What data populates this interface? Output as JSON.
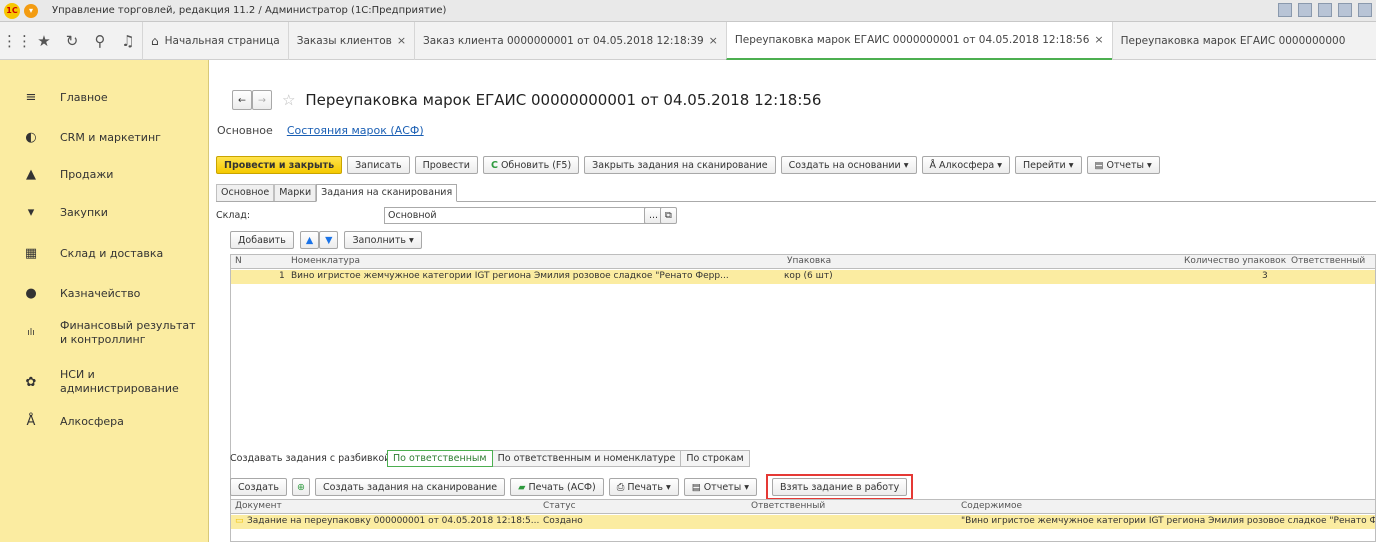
{
  "app_title": "Управление торговлей, редакция 11.2 / Администратор  (1С:Предприятие)",
  "home_tab": "Начальная страница",
  "tabs": [
    {
      "label": "Заказы клиентов",
      "close": "×"
    },
    {
      "label": "Заказ клиента 0000000001 от 04.05.2018 12:18:39",
      "close": "×"
    },
    {
      "label": "Переупаковка марок ЕГАИС 0000000001 от 04.05.2018 12:18:56",
      "close": "×"
    },
    {
      "label": "Переупаковка марок ЕГАИС 0000000000"
    }
  ],
  "sidebar": {
    "items": [
      {
        "icon": "menu-icon",
        "glyph": "≡",
        "label": "Главное"
      },
      {
        "icon": "crm-icon",
        "glyph": "◐",
        "label": "CRM и маркетинг"
      },
      {
        "icon": "bag-icon",
        "glyph": "▲",
        "label": "Продажи"
      },
      {
        "icon": "cart-icon",
        "glyph": "▾",
        "label": "Закупки"
      },
      {
        "icon": "warehouse-icon",
        "glyph": "▦",
        "label": "Склад и доставка"
      },
      {
        "icon": "treasury-icon",
        "glyph": "●",
        "label": "Казначейство"
      },
      {
        "icon": "chart-icon",
        "glyph": "ılı",
        "label": "Финансовый результат и контроллинг"
      },
      {
        "icon": "gear-icon",
        "glyph": "✿",
        "label": "НСИ и администрирование"
      },
      {
        "icon": "alcosphere-icon",
        "glyph": "Å",
        "label": "Алкосфера"
      }
    ]
  },
  "doc": {
    "title": "Переупаковка марок ЕГАИС 00000000001 от 04.05.2018 12:18:56",
    "nav_main": "Основное",
    "nav_link": "Состояния марок (АСФ)"
  },
  "toolbar": {
    "post_close": "Провести и закрыть",
    "save": "Записать",
    "post": "Провести",
    "refresh": "Обновить (F5)",
    "close_tasks": "Закрыть задания на сканирование",
    "create_basis": "Создать на основании",
    "alcosphere": "Алкосфера",
    "goto": "Перейти",
    "reports": "Отчеты"
  },
  "inner_tabs": [
    "Основное",
    "Марки",
    "Задания на сканирования"
  ],
  "warehouse": {
    "label": "Склад:",
    "value": "Основной"
  },
  "table_toolbar": {
    "add": "Добавить",
    "fill": "Заполнить"
  },
  "table": {
    "headers": [
      "N",
      "Номенклатура",
      "Упаковка",
      "Количество упаковок",
      "Ответственный"
    ],
    "rows": [
      {
        "n": "1",
        "nom": "Вино игристое жемчужное категории IGT региона Эмилия розовое сладкое \"Ренато Ферр...",
        "pack": "кор (6 шт)",
        "qty": "3",
        "resp": ""
      }
    ]
  },
  "split": {
    "label": "Создавать задания с разбивкой:",
    "options": [
      "По ответственным",
      "По ответственным и номенклатуре",
      "По строкам"
    ]
  },
  "bottom_toolbar": {
    "create": "Создать",
    "create_tasks": "Создать задания на сканирование",
    "print_asf": "Печать (АСФ)",
    "print": "Печать",
    "reports": "Отчеты",
    "take_task": "Взять задание в работу"
  },
  "bottom_table": {
    "headers": [
      "Документ",
      "Статус",
      "Ответственный",
      "Содержимое"
    ],
    "rows": [
      {
        "doc": "Задание на переупаковку 000000001 от 04.05.2018 12:18:5...",
        "status": "Создано",
        "resp": "",
        "content": "\"Вино игристое жемчужное категории IGT региона Эмилия розовое сладкое \"Ренато Фер"
      }
    ]
  },
  "colors": {
    "accent_yellow": "#f5c900",
    "sidebar_bg": "#fbeca1",
    "highlight_red": "#e53935",
    "refresh_green": "#2e9a3e"
  }
}
